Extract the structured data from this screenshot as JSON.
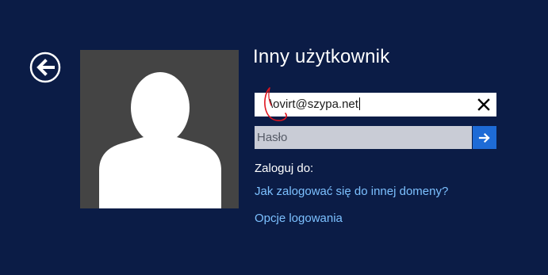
{
  "screen": {
    "title": "Inny użytkownik",
    "back_icon": "back-arrow-circle-icon",
    "avatar_icon": "user-silhouette-icon"
  },
  "username": {
    "value": "\\ovirt@szypa.net",
    "clear_icon": "close-icon"
  },
  "password": {
    "placeholder": "Hasło",
    "submit_icon": "arrow-right-icon"
  },
  "signin_to_label": "Zaloguj do:",
  "links": {
    "other_domain": "Jak zalogować się do innej domeny?",
    "signin_options": "Opcje logowania"
  },
  "colors": {
    "background": "#0b1c46",
    "accent": "#1e6bd6",
    "link": "#7cc0ff",
    "annotation": "#e0141e"
  }
}
